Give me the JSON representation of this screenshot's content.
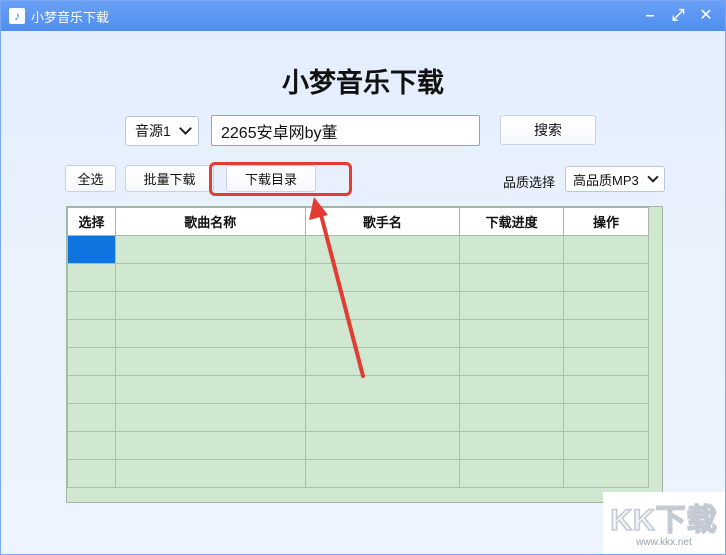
{
  "window": {
    "title": "小梦音乐下载",
    "icon": "music-note-icon"
  },
  "app": {
    "heading": "小梦音乐下载"
  },
  "search": {
    "source_value": "音源1",
    "query_value": "2265安卓网by董",
    "search_label": "搜索"
  },
  "toolbar": {
    "select_all_label": "全选",
    "batch_download_label": "批量下载",
    "download_dir_label": "下载目录",
    "quality_label": "品质选择",
    "quality_value": "高品质MP3"
  },
  "table": {
    "headers": [
      "选择",
      "歌曲名称",
      "歌手名",
      "下载进度",
      "操作"
    ],
    "rows": [
      {
        "selected": true
      },
      {
        "selected": false
      },
      {
        "selected": false
      },
      {
        "selected": false
      },
      {
        "selected": false
      },
      {
        "selected": false
      },
      {
        "selected": false
      },
      {
        "selected": false
      },
      {
        "selected": false
      }
    ]
  },
  "annotation": {
    "highlight_color": "#e23c33"
  },
  "watermark": {
    "logo": "KK下载",
    "url": "www.kkx.net"
  },
  "colors": {
    "titlebar": "#5b97f3",
    "table_bg": "#cfe8cf",
    "selected_cell": "#0f73e0"
  }
}
